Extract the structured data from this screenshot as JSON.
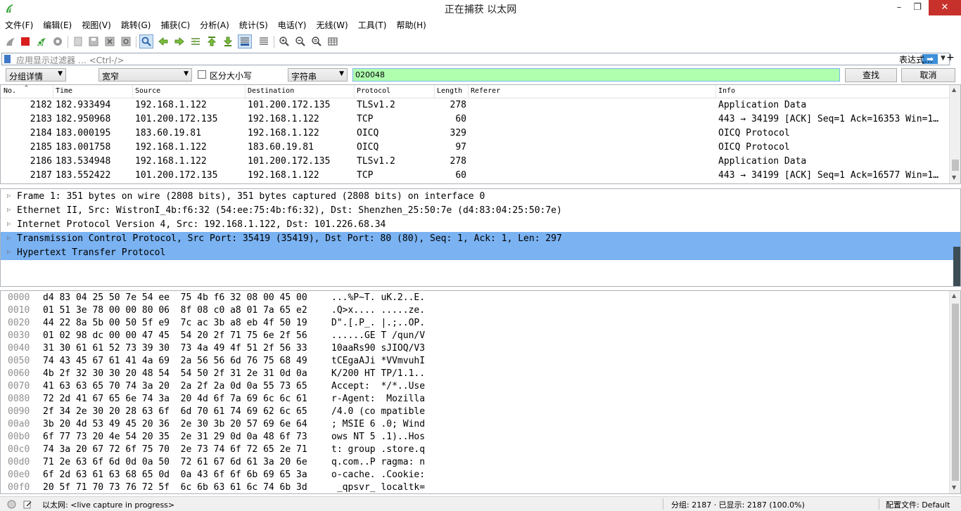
{
  "window": {
    "title": "正在捕获 以太网",
    "min_glyph": "–",
    "max_glyph": "❐",
    "close_glyph": "✕"
  },
  "menu": [
    "文件(F)",
    "编辑(E)",
    "视图(V)",
    "跳转(G)",
    "捕获(C)",
    "分析(A)",
    "统计(S)",
    "电话(Y)",
    "无线(W)",
    "工具(T)",
    "帮助(H)"
  ],
  "filter": {
    "placeholder": "应用显示过滤器 … <Ctrl-/>",
    "apply_glyph": "➡",
    "expression_label": "表达式…",
    "add_glyph": "+"
  },
  "find": {
    "search_in": "分组详情",
    "char_width": "宽窄",
    "case_label": "区分大小写",
    "search_type": "字符串",
    "value": "020048",
    "find_button": "查找",
    "cancel_button": "取消"
  },
  "packet_list": {
    "columns": [
      "No.",
      "Time",
      "Source",
      "Destination",
      "Protocol",
      "Length",
      "Referer",
      "Info"
    ],
    "rows": [
      {
        "no": "2182",
        "time": "182.933494",
        "src": "192.168.1.122",
        "dst": "101.200.172.135",
        "proto": "TLSv1.2",
        "len": "278",
        "info": "Application Data"
      },
      {
        "no": "2183",
        "time": "182.950968",
        "src": "101.200.172.135",
        "dst": "192.168.1.122",
        "proto": "TCP",
        "len": "60",
        "info": "443 → 34199 [ACK] Seq=1 Ack=16353 Win=1…"
      },
      {
        "no": "2184",
        "time": "183.000195",
        "src": "183.60.19.81",
        "dst": "192.168.1.122",
        "proto": "OICQ",
        "len": "329",
        "info": "OICQ Protocol"
      },
      {
        "no": "2185",
        "time": "183.001758",
        "src": "192.168.1.122",
        "dst": "183.60.19.81",
        "proto": "OICQ",
        "len": "97",
        "info": "OICQ Protocol"
      },
      {
        "no": "2186",
        "time": "183.534948",
        "src": "192.168.1.122",
        "dst": "101.200.172.135",
        "proto": "TLSv1.2",
        "len": "278",
        "info": "Application Data"
      },
      {
        "no": "2187",
        "time": "183.552422",
        "src": "101.200.172.135",
        "dst": "192.168.1.122",
        "proto": "TCP",
        "len": "60",
        "info": "443 → 34199 [ACK] Seq=1 Ack=16577 Win=1…"
      }
    ]
  },
  "details": [
    "Frame 1: 351 bytes on wire (2808 bits), 351 bytes captured (2808 bits) on interface 0",
    "Ethernet II, Src: WistronI_4b:f6:32 (54:ee:75:4b:f6:32), Dst: Shenzhen_25:50:7e (d4:83:04:25:50:7e)",
    "Internet Protocol Version 4, Src: 192.168.1.122, Dst: 101.226.68.34",
    "Transmission Control Protocol, Src Port: 35419 (35419), Dst Port: 80 (80), Seq: 1, Ack: 1, Len: 297",
    "Hypertext Transfer Protocol"
  ],
  "hex_rows": [
    {
      "off": "0000",
      "bytes": "d4 83 04 25 50 7e 54 ee  75 4b f6 32 08 00 45 00",
      "ascii": "...%P~T. uK.2..E."
    },
    {
      "off": "0010",
      "bytes": "01 51 3e 78 00 00 80 06  8f 08 c0 a8 01 7a 65 e2",
      "ascii": ".Q>x.... .....ze."
    },
    {
      "off": "0020",
      "bytes": "44 22 8a 5b 00 50 5f e9  7c ac 3b a8 eb 4f 50 19",
      "ascii": "D\".[.P_. |.;..OP."
    },
    {
      "off": "0030",
      "bytes": "01 02 98 dc 00 00 47 45  54 20 2f 71 75 6e 2f 56",
      "ascii": "......GE T /qun/V"
    },
    {
      "off": "0040",
      "bytes": "31 30 61 61 52 73 39 30  73 4a 49 4f 51 2f 56 33",
      "ascii": "10aaRs90 sJIOQ/V3"
    },
    {
      "off": "0050",
      "bytes": "74 43 45 67 61 41 4a 69  2a 56 56 6d 76 75 68 49",
      "ascii": "tCEgaAJi *VVmvuhI"
    },
    {
      "off": "0060",
      "bytes": "4b 2f 32 30 30 20 48 54  54 50 2f 31 2e 31 0d 0a",
      "ascii": "K/200 HT TP/1.1.."
    },
    {
      "off": "0070",
      "bytes": "41 63 63 65 70 74 3a 20  2a 2f 2a 0d 0a 55 73 65",
      "ascii": "Accept:  */*..Use"
    },
    {
      "off": "0080",
      "bytes": "72 2d 41 67 65 6e 74 3a  20 4d 6f 7a 69 6c 6c 61",
      "ascii": "r-Agent:  Mozilla"
    },
    {
      "off": "0090",
      "bytes": "2f 34 2e 30 20 28 63 6f  6d 70 61 74 69 62 6c 65",
      "ascii": "/4.0 (co mpatible"
    },
    {
      "off": "00a0",
      "bytes": "3b 20 4d 53 49 45 20 36  2e 30 3b 20 57 69 6e 64",
      "ascii": "; MSIE 6 .0; Wind"
    },
    {
      "off": "00b0",
      "bytes": "6f 77 73 20 4e 54 20 35  2e 31 29 0d 0a 48 6f 73",
      "ascii": "ows NT 5 .1)..Hos"
    },
    {
      "off": "00c0",
      "bytes": "74 3a 20 67 72 6f 75 70  2e 73 74 6f 72 65 2e 71",
      "ascii": "t: group .store.q"
    },
    {
      "off": "00d0",
      "bytes": "71 2e 63 6f 6d 0d 0a 50  72 61 67 6d 61 3a 20 6e",
      "ascii": "q.com..P ragma: n"
    },
    {
      "off": "00e0",
      "bytes": "6f 2d 63 61 63 68 65 0d  0a 43 6f 6f 6b 69 65 3a",
      "ascii": "o-cache. .Cookie:"
    },
    {
      "off": "00f0",
      "bytes": "20 5f 71 70 73 76 72 5f  6c 6b 63 61 6c 74 6b 3d",
      "ascii": " _qpsvr_ localtk="
    }
  ],
  "status": {
    "capture": "以太网: <live capture in progress>",
    "packets": "分组: 2187 · 已显示: 2187 (100.0%)",
    "profile": "配置文件: Default"
  },
  "colors": {
    "selection": "#7ab2f2",
    "find_input_bg": "#afffaf",
    "close_button": "#c7312b"
  }
}
